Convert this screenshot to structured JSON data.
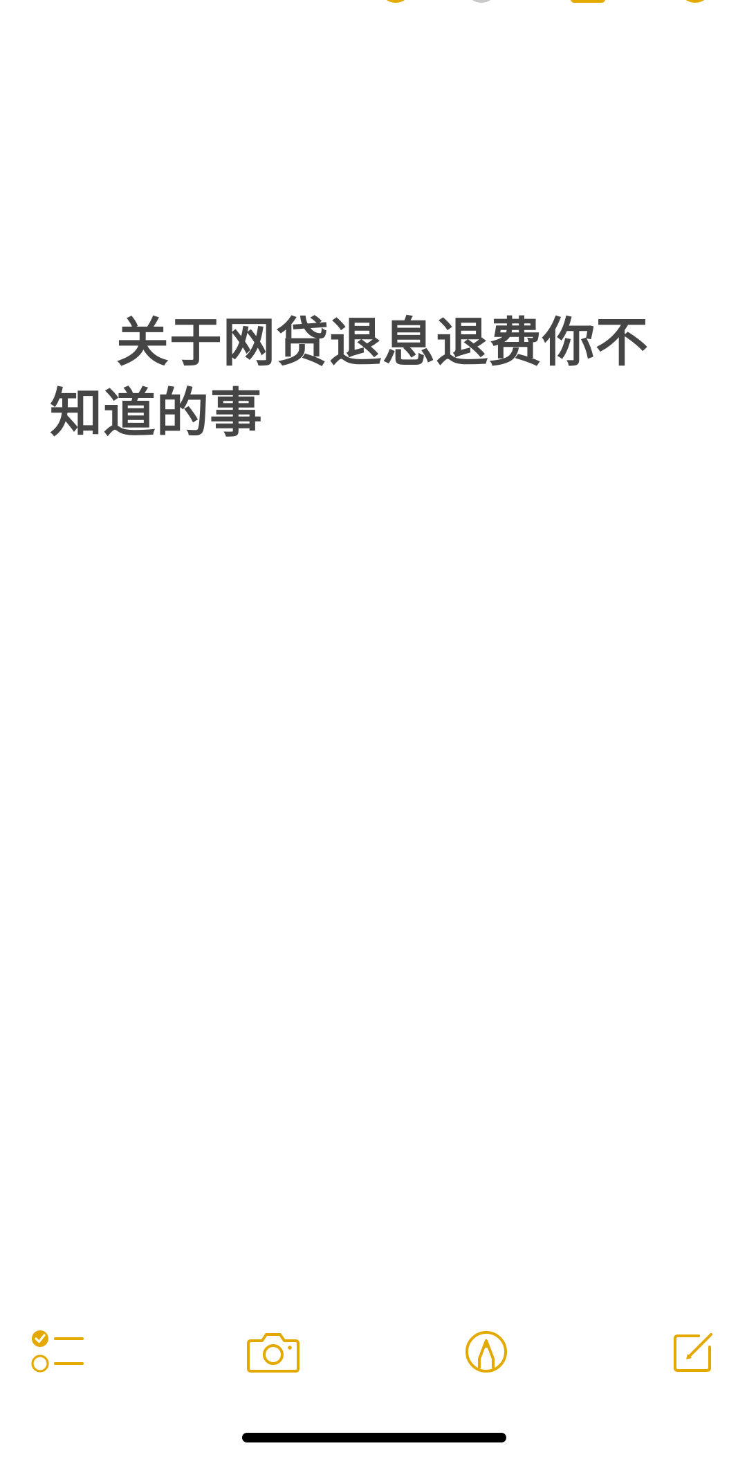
{
  "note": {
    "title_line1": "关于网贷退息退费你不",
    "title_line2": "知道的事"
  },
  "toolbar": {
    "items": [
      {
        "icon": "checklist-icon"
      },
      {
        "icon": "camera-icon"
      },
      {
        "icon": "markup-pen-icon"
      },
      {
        "icon": "compose-icon"
      }
    ]
  },
  "colors": {
    "accent": "#e3a900",
    "text": "#454545",
    "background": "#ffffff",
    "home_indicator": "#000000"
  }
}
